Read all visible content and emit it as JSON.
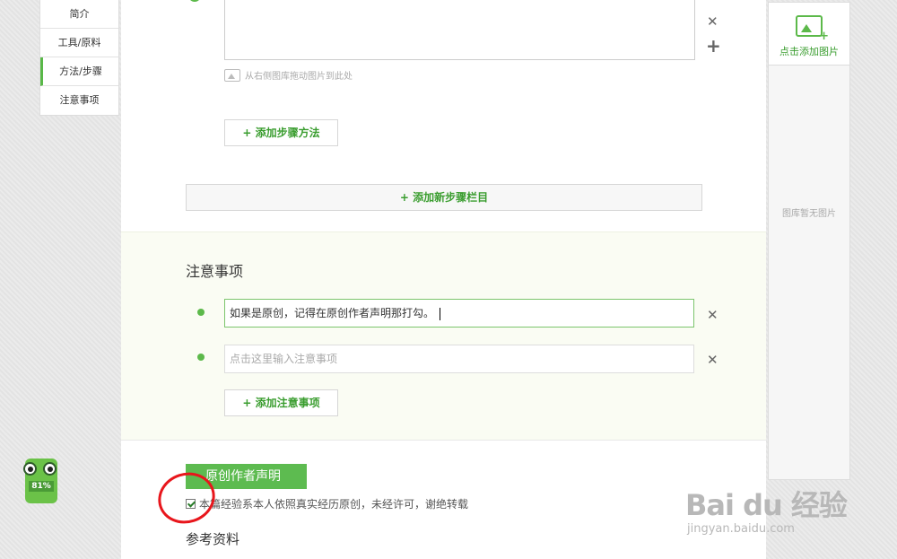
{
  "nav": {
    "items": [
      {
        "label": "简介",
        "active": false
      },
      {
        "label": "工具/原料",
        "active": false
      },
      {
        "label": "方法/步骤",
        "active": true
      },
      {
        "label": "注意事项",
        "active": false
      }
    ]
  },
  "step": {
    "drag_hint": "从右侧图库拖动图片到此处",
    "add_step_method": "+ 添加步骤方法",
    "add_step_column": "+ 添加新步骤栏目"
  },
  "notes": {
    "title": "注意事项",
    "items": [
      {
        "value": "如果是原创，记得在原创作者声明那打勾。",
        "placeholder": ""
      },
      {
        "value": "",
        "placeholder": "点击这里输入注意事项"
      }
    ],
    "add_label": "+ 添加注意事项"
  },
  "declaration": {
    "title": "原创作者声明",
    "checkbox_label": "本篇经验系本人依照真实经历原创，未经许可，谢绝转载",
    "checked": true
  },
  "references": {
    "title": "参考资料"
  },
  "gallery": {
    "add_label": "点击添加图片",
    "empty_text": "图库暂无图片"
  },
  "mascot": {
    "percent": "81%"
  },
  "watermark": {
    "brand": "Bai du 经验",
    "url": "jingyan.baidu.com"
  },
  "colors": {
    "accent": "#5cb94a",
    "annotation": "#e8161c"
  },
  "icons": {
    "close": "close-icon",
    "add": "plus-icon",
    "image": "image-icon"
  }
}
